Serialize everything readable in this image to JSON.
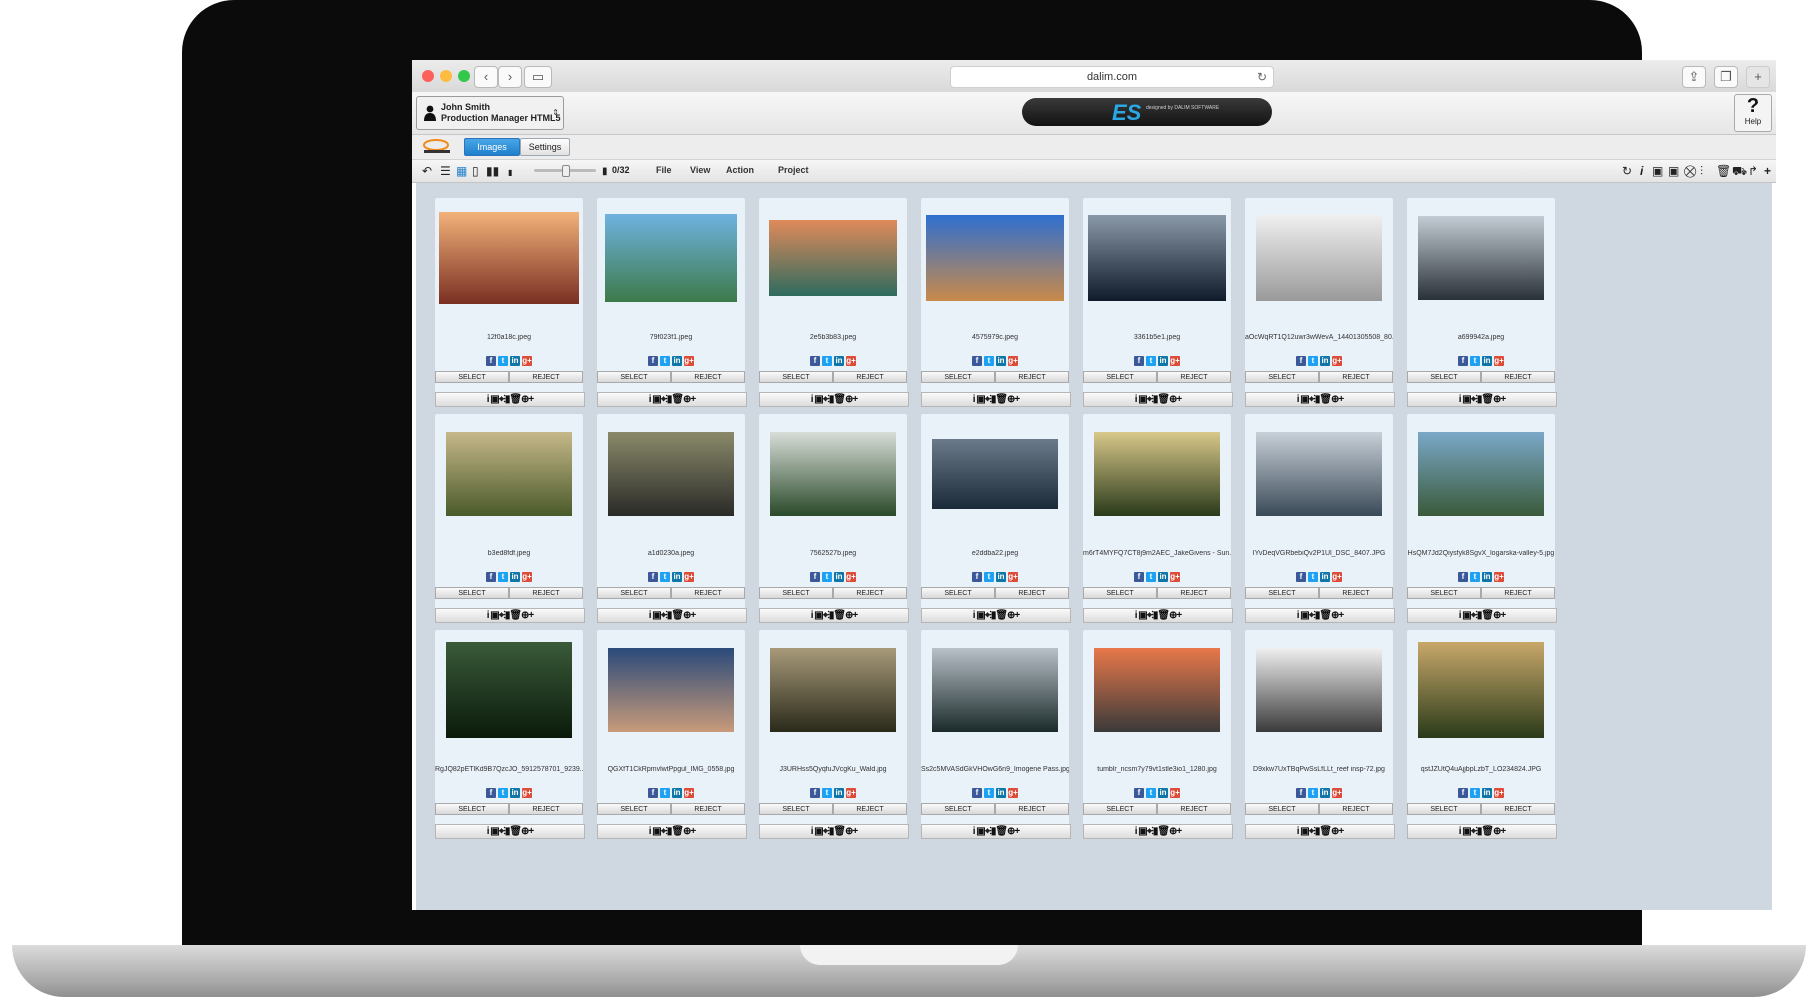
{
  "browser": {
    "url": "dalim.com"
  },
  "header": {
    "user_name": "John Smith",
    "user_role": "Production Manager HTML5",
    "brand_mark": "ES",
    "brand_tagline": "designed by DALIM SOFTWARE",
    "help_label": "Help"
  },
  "tabs": [
    {
      "label": "Images",
      "active": true
    },
    {
      "label": "Settings",
      "active": false
    }
  ],
  "toolbar": {
    "counter": "0/32",
    "menus": [
      "File",
      "View",
      "Action",
      "Project"
    ]
  },
  "buttons": {
    "select": "SELECT",
    "reject": "REJECT"
  },
  "social": {
    "fb": "f",
    "tw": "t",
    "li": "in",
    "gp": "g+"
  },
  "actions_label": "i ▣⌖⫶▮🗑⊕+",
  "colors": {
    "accent": "#2aa8e6",
    "tab_active": "#1f7fcc",
    "grid_bg": "#cfd8e1",
    "card_bg": "#e9f1f9"
  },
  "images": [
    {
      "file": "12f0a18c.jpeg",
      "c1": "#f2b27a",
      "c2": "#7a2f22",
      "w": 140,
      "h": 92
    },
    {
      "file": "79f023f1.jpeg",
      "c1": "#6fb2e0",
      "c2": "#3d7a4a",
      "w": 132,
      "h": 88
    },
    {
      "file": "2e5b3b83.jpeg",
      "c1": "#e08a5a",
      "c2": "#2e6b5e",
      "w": 128,
      "h": 76
    },
    {
      "file": "4575979c.jpeg",
      "c1": "#2f6fd0",
      "c2": "#c98a4a",
      "w": 138,
      "h": 86
    },
    {
      "file": "3361b5e1.jpeg",
      "c1": "#8a99a8",
      "c2": "#0f1a2a",
      "w": 138,
      "h": 86
    },
    {
      "file": "aOcWqRT1Q12uwr3wWevA_14401305508_80...",
      "c1": "#f0f0f0",
      "c2": "#9a9a9a",
      "w": 126,
      "h": 86
    },
    {
      "file": "a699942a.jpeg",
      "c1": "#c3ccd4",
      "c2": "#2a3038",
      "w": 126,
      "h": 84
    },
    {
      "file": "b3ed8fdf.jpeg",
      "c1": "#c6b88a",
      "c2": "#4a5a2a",
      "w": 126,
      "h": 84
    },
    {
      "file": "a1d0230a.jpeg",
      "c1": "#8a8a6a",
      "c2": "#2a2a28",
      "w": 126,
      "h": 84
    },
    {
      "file": "7562527b.jpeg",
      "c1": "#d8ddd8",
      "c2": "#2a4a2a",
      "w": 126,
      "h": 84
    },
    {
      "file": "e2ddba22.jpeg",
      "c1": "#6a7a8a",
      "c2": "#1a2a38",
      "w": 126,
      "h": 70
    },
    {
      "file": "m6rT4MYFQ7CT8j9m2AEC_JakeGivens - Sun...",
      "c1": "#d8c88a",
      "c2": "#2a3a1a",
      "w": 126,
      "h": 84
    },
    {
      "file": "IYvDeqVGRbebiQv2P1Ul_DSC_8407.JPG",
      "c1": "#c8d0d8",
      "c2": "#3a4a58",
      "w": 126,
      "h": 84
    },
    {
      "file": "HsQM7Jd2Qiysfyk8SgvX_logarska-valley-5.jpg",
      "c1": "#7aa8c8",
      "c2": "#3a5a3a",
      "w": 126,
      "h": 84
    },
    {
      "file": "RgJQ82pETlKd9B7QzcJO_5912578701_9239...",
      "c1": "#3a5a3a",
      "c2": "#0a1a0a",
      "w": 126,
      "h": 96
    },
    {
      "file": "QGXfT1CkRpmvlwtPpgul_IMG_0558.jpg",
      "c1": "#2a4a7a",
      "c2": "#c89a7a",
      "w": 126,
      "h": 84
    },
    {
      "file": "J3URHss5QyqfuJVcgKu_Wald.jpg",
      "c1": "#a89a7a",
      "c2": "#2a2a1a",
      "w": 126,
      "h": 84
    },
    {
      "file": "Ss2c5MVASdGkVHOwG6n9_Imogene Pass.jpg",
      "c1": "#b8c0c8",
      "c2": "#1a2a2a",
      "w": 126,
      "h": 84
    },
    {
      "file": "tumblr_ncsm7y79vt1stle3io1_1280.jpg",
      "c1": "#e8784a",
      "c2": "#3a3a3a",
      "w": 126,
      "h": 84
    },
    {
      "file": "D9xkw7UxTBqPwSsLfLLt_reef insp-72.jpg",
      "c1": "#f0f0f0",
      "c2": "#3a3a3a",
      "w": 126,
      "h": 84
    },
    {
      "file": "qstJZUtQ4uAjjbpLzbT_LO234824.JPG",
      "c1": "#c8a86a",
      "c2": "#2a3a1a",
      "w": 126,
      "h": 96
    }
  ]
}
